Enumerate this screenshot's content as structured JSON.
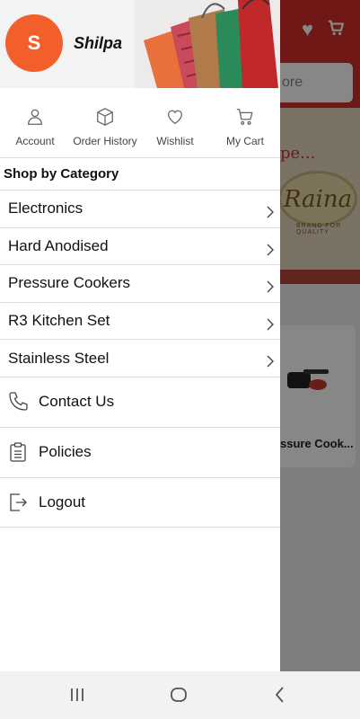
{
  "user": {
    "initial": "S",
    "name": "Shilpa"
  },
  "quick_links": [
    {
      "label": "Account",
      "icon": "person-icon"
    },
    {
      "label": "Order History",
      "icon": "box-icon"
    },
    {
      "label": "Wishlist",
      "icon": "heart-icon"
    },
    {
      "label": "My Cart",
      "icon": "cart-icon"
    }
  ],
  "category_section": {
    "title": "Shop by Category"
  },
  "categories": [
    {
      "label": "Electronics"
    },
    {
      "label": "Hard Anodised"
    },
    {
      "label": "Pressure Cookers"
    },
    {
      "label": "R3 Kitchen Set"
    },
    {
      "label": "Stainless Steel"
    }
  ],
  "menu": [
    {
      "label": "Contact Us",
      "icon": "phone-icon"
    },
    {
      "label": "Policies",
      "icon": "clipboard-icon"
    },
    {
      "label": "Logout",
      "icon": "logout-icon"
    }
  ],
  "background": {
    "search_placeholder": "ore",
    "promo_text": "pe...",
    "brand_logo_text": "Raina",
    "brand_tagline": "BRAND FOR QUALITY",
    "product_name": "ssure Cook..."
  },
  "colors": {
    "brand_red": "#d42f2a",
    "avatar_orange": "#f25f2b"
  }
}
